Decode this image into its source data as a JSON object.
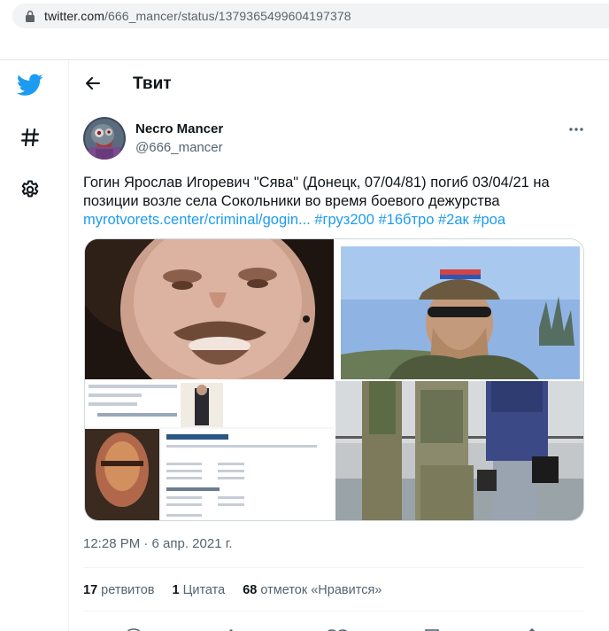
{
  "browser": {
    "url_host": "twitter.com",
    "url_path": "/666_mancer/status/1379365499604197378"
  },
  "nav": {
    "logo_icon": "twitter-bird-icon",
    "explore_icon": "hashtag-icon",
    "settings_icon": "gear-icon"
  },
  "header": {
    "back_icon": "arrow-left-icon",
    "title": "Твит"
  },
  "tweet": {
    "author_name": "Necro Mancer",
    "author_handle": "@666_mancer",
    "text_plain": "Гогин Ярослав Игоревич \"Сява\" (Донецк, 07/04/81) погиб 03/04/21 на позиции возле села Сокольники во время боевого дежурства",
    "links": [
      "myrotvorets.center/criminal/gogin...",
      "#груз200",
      "#16бтро",
      "#2ак",
      "#роа"
    ],
    "timestamp": "12:28 PM · 6 апр. 2021 г.",
    "media_count": 4
  },
  "stats": {
    "retweets_count": "17",
    "retweets_label": "ретвитов",
    "quotes_count": "1",
    "quotes_label": "Цитата",
    "likes_count": "68",
    "likes_label": "отметок «Нравится»"
  },
  "colors": {
    "accent": "#1d9bf0",
    "text": "#0f1419",
    "secondary": "#536471",
    "border": "#eff3f4"
  }
}
